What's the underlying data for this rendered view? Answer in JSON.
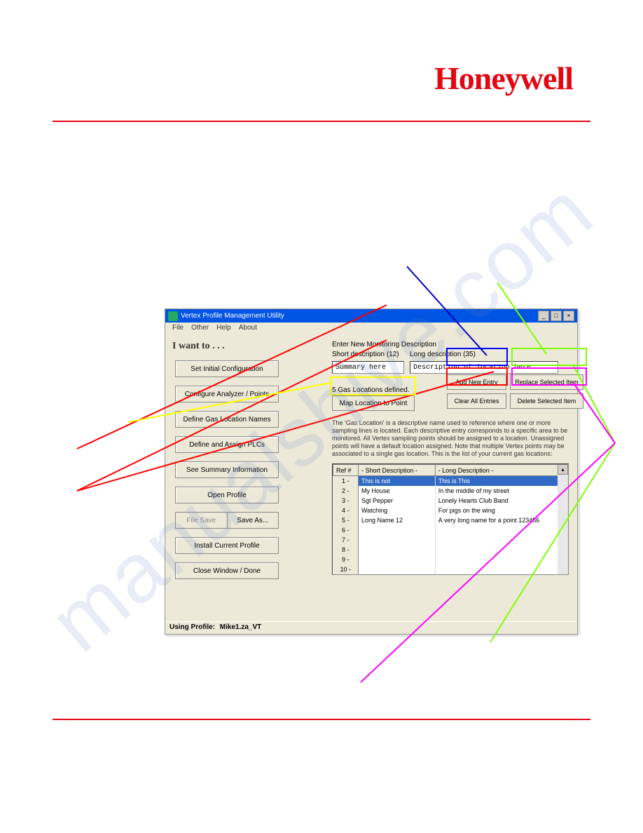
{
  "logo": "Honeywell",
  "watermark": "manualshive.com",
  "window": {
    "title": "Vertex Profile Management Utility",
    "menu": [
      "File",
      "Other",
      "Help",
      "About"
    ],
    "iwant": "I want to  . . .",
    "tasks": {
      "set_initial": "Set Initial Configuration",
      "configure_analyzer": "Configure Analyzer / Points",
      "define_gas": "Define Gas Location Names",
      "define_plc": "Define and Assign PLCs",
      "see_summary": "See Summary Information",
      "open_profile": "Open Profile",
      "file_save": "File Save",
      "save_as": "Save As...",
      "install": "Install Current Profile",
      "close": "Close Window / Done"
    },
    "enter_label": "Enter New Monitoring Description",
    "short_label": "Short description (12)",
    "long_label": "Long description (35)",
    "short_input": "Summary here",
    "long_input": "Description of location here.",
    "loc_defined": "5  Gas Locations defined.",
    "map_btn": "Map Location to Point",
    "actions": {
      "add": "Add New Entry",
      "replace": "Replace Selected Item",
      "clear": "Clear All Entries",
      "delete": "Delete Selected Item"
    },
    "info_text": "The 'Gas Location' is a descriptive name used to reference where one or more sampling lines is located.  Each descriptive entry corresponds to a specific area to be monitored.\nAll Vertex sampling points should be assigned to a location.  Unassigned points will have a default location assigned. Note that multiple Vertex points may be associated to a single gas location.  This is the list of your current gas locations:",
    "table": {
      "headers": [
        "Ref #",
        "- Short Description -",
        "- Long Description -"
      ],
      "rows": [
        {
          "ref": "1 -",
          "short": "This is not",
          "long": "This is This"
        },
        {
          "ref": "2 -",
          "short": "My House",
          "long": "In the middle of my street"
        },
        {
          "ref": "3 -",
          "short": "Sgt Pepper",
          "long": "Lonely Hearts Club Band"
        },
        {
          "ref": "4 -",
          "short": "Watching",
          "long": "For pigs on the wing"
        },
        {
          "ref": "5 -",
          "short": "Long Name 12",
          "long": "A very long name for a point 123456"
        },
        {
          "ref": "6 -",
          "short": "",
          "long": ""
        },
        {
          "ref": "7 -",
          "short": "",
          "long": ""
        },
        {
          "ref": "8 -",
          "short": "",
          "long": ""
        },
        {
          "ref": "9 -",
          "short": "",
          "long": ""
        },
        {
          "ref": "10 -",
          "short": "",
          "long": ""
        }
      ]
    },
    "status_label": "Using Profile:",
    "status_value": "Mike1.za_VT"
  }
}
